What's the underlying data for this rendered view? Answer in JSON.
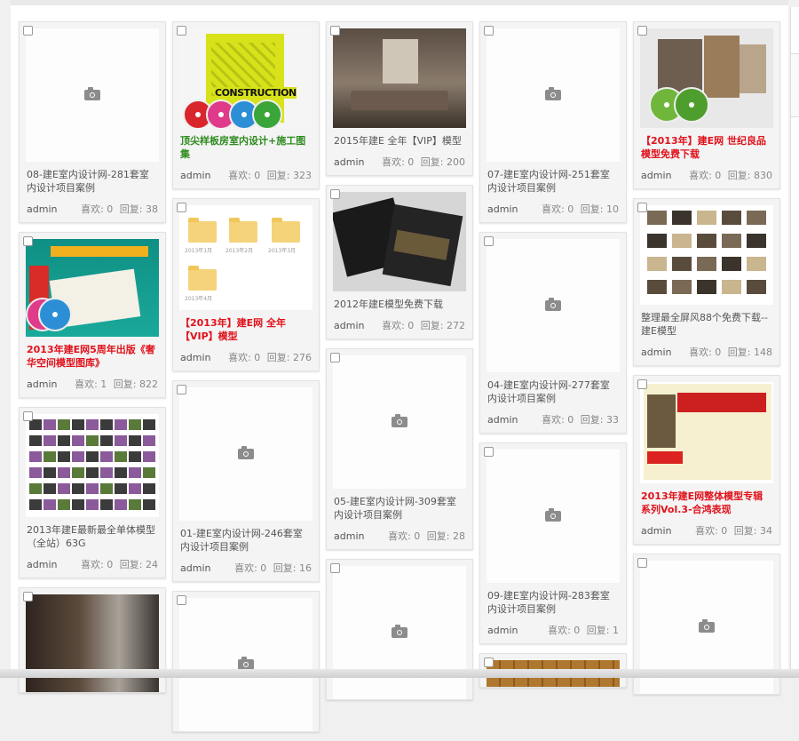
{
  "columns": [
    [
      {
        "title": "08-建E室内设计网-281套室内设计项目案例",
        "style": "normal",
        "thumb": "placeholder",
        "author": "admin",
        "likes": "喜欢: 0",
        "replies": "回复: 38"
      },
      {
        "title": "2013年建E网5周年出版《奢华空间模型图库》",
        "style": "red",
        "thumb": "book2",
        "author": "admin",
        "likes": "喜欢: 1",
        "replies": "回复: 822"
      },
      {
        "title": "2013年建E最新最全单体模型（全站）63G",
        "style": "normal",
        "thumb": "models",
        "author": "admin",
        "likes": "喜欢: 0",
        "replies": "回复: 24"
      },
      {
        "title": "",
        "style": "normal",
        "thumb": "interior",
        "author": "",
        "likes": "",
        "replies": ""
      }
    ],
    [
      {
        "title": "顶尖样板房室内设计+施工图集",
        "style": "green",
        "thumb": "book",
        "author": "admin",
        "likes": "喜欢: 0",
        "replies": "回复: 323"
      },
      {
        "title": "【2013年】建E网 全年【VIP】模型",
        "style": "red",
        "thumb": "folders",
        "author": "admin",
        "likes": "喜欢: 0",
        "replies": "回复: 276"
      },
      {
        "title": "01-建E室内设计网-246套室内设计项目案例",
        "style": "normal",
        "thumb": "placeholder",
        "author": "admin",
        "likes": "喜欢: 0",
        "replies": "回复: 16"
      },
      {
        "title": "",
        "style": "normal",
        "thumb": "placeholder",
        "author": "",
        "likes": "",
        "replies": ""
      }
    ],
    [
      {
        "title": "2015年建E 全年【VIP】模型",
        "style": "normal",
        "thumb": "room",
        "author": "admin",
        "likes": "喜欢: 0",
        "replies": "回复: 200"
      },
      {
        "title": "2012年建E模型免费下载",
        "style": "normal",
        "thumb": "dark",
        "author": "admin",
        "likes": "喜欢: 0",
        "replies": "回复: 272"
      },
      {
        "title": "05-建E室内设计网-309套室内设计项目案例",
        "style": "normal",
        "thumb": "placeholder",
        "author": "admin",
        "likes": "喜欢: 0",
        "replies": "回复: 28"
      },
      {
        "title": "",
        "style": "normal",
        "thumb": "placeholder",
        "author": "",
        "likes": "",
        "replies": ""
      }
    ],
    [
      {
        "title": "07-建E室内设计网-251套室内设计项目案例",
        "style": "normal",
        "thumb": "placeholder",
        "author": "admin",
        "likes": "喜欢: 0",
        "replies": "回复: 10"
      },
      {
        "title": "04-建E室内设计网-277套室内设计项目案例",
        "style": "normal",
        "thumb": "placeholder",
        "author": "admin",
        "likes": "喜欢: 0",
        "replies": "回复: 33"
      },
      {
        "title": "09-建E室内设计网-283套室内设计项目案例",
        "style": "normal",
        "thumb": "placeholder",
        "author": "admin",
        "likes": "喜欢: 0",
        "replies": "回复: 1"
      },
      {
        "title": "",
        "style": "normal",
        "thumb": "wood",
        "author": "",
        "likes": "",
        "replies": ""
      }
    ],
    [
      {
        "title": "【2013年】建E网 世纪良品 模型免费下载",
        "style": "red",
        "thumb": "collage",
        "author": "admin",
        "likes": "喜欢: 0",
        "replies": "回复: 830"
      },
      {
        "title": "整理最全屏风88个免费下载--建E模型",
        "style": "normal",
        "thumb": "grid",
        "author": "admin",
        "likes": "喜欢: 0",
        "replies": "回复: 148"
      },
      {
        "title": "2013年建E网整体模型专辑系列Vol.3-合鸿表现",
        "style": "red",
        "thumb": "promo",
        "author": "admin",
        "likes": "喜欢: 0",
        "replies": "回复: 34"
      },
      {
        "title": "",
        "style": "normal",
        "thumb": "placeholder",
        "author": "",
        "likes": "",
        "replies": ""
      }
    ]
  ],
  "thumb_text": {
    "book_word": "CONSTRUCTION",
    "folder_labels": [
      "2013年1月",
      "2013年2月",
      "2013年3月",
      "2013年4月"
    ]
  },
  "colors": {
    "red_title": "#e0121b",
    "green_title": "#2e8b1e",
    "card_bg": "#f4f4f4"
  }
}
